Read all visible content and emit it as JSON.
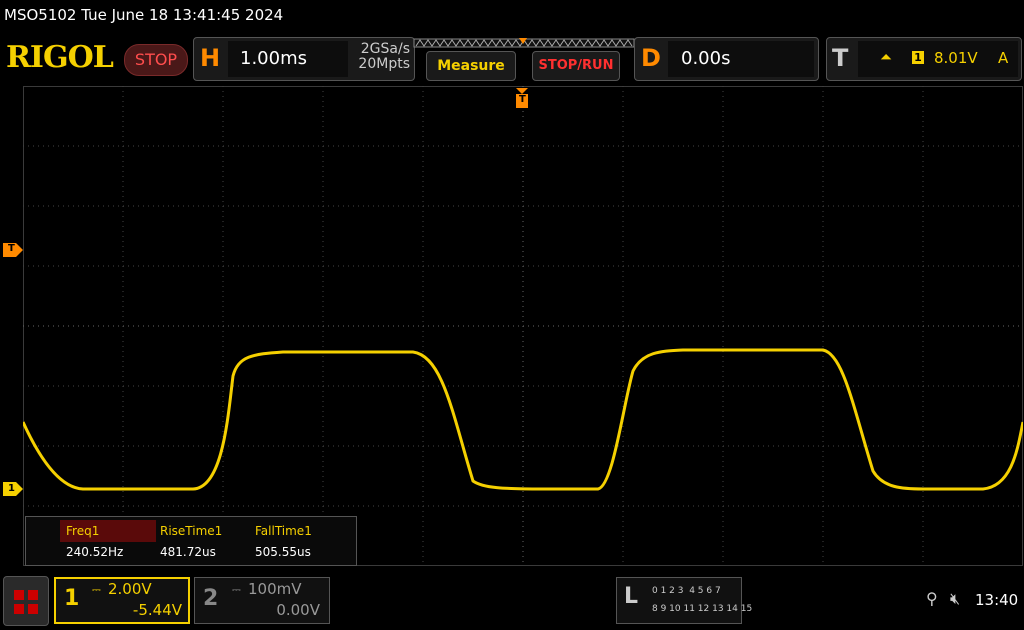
{
  "status_line": "MSO5102  Tue June 18 13:41:45 2024",
  "logo": "RIGOL",
  "run_state": "STOP",
  "horizontal": {
    "letter": "H",
    "timebase": "1.00ms",
    "sample_rate": "2GSa/s",
    "memory_depth": "20Mpts"
  },
  "buttons": {
    "measure": "Measure",
    "stop_run": "STOP/RUN"
  },
  "delay": {
    "letter": "D",
    "value": "0.00s"
  },
  "trigger": {
    "letter": "T",
    "source": "1",
    "level": "8.01V",
    "mode": "A",
    "marker": "T"
  },
  "channel_marker": "1",
  "measurements": [
    {
      "label": "Freq1",
      "value": "240.52Hz"
    },
    {
      "label": "RiseTime1",
      "value": "481.72us"
    },
    {
      "label": "FallTime1",
      "value": "505.55us"
    }
  ],
  "ch1": {
    "num": "1",
    "scale": "2.00V",
    "offset": "-5.44V"
  },
  "ch2": {
    "num": "2",
    "scale": "100mV",
    "offset": "0.00V"
  },
  "logic": {
    "letter": "L",
    "row1": "0 1 2 3  4 5 6 7",
    "row2": "8 9 10 11 12 13 14 15"
  },
  "clock": "13:40",
  "colors": {
    "ch1": "#f5d000",
    "accent": "#ff8a00",
    "stop": "#ff3030"
  },
  "icons": [
    "menu-icon",
    "usb-icon",
    "speaker-mute-icon",
    "trigger-edge-icon",
    "coupling-dc-icon"
  ]
}
